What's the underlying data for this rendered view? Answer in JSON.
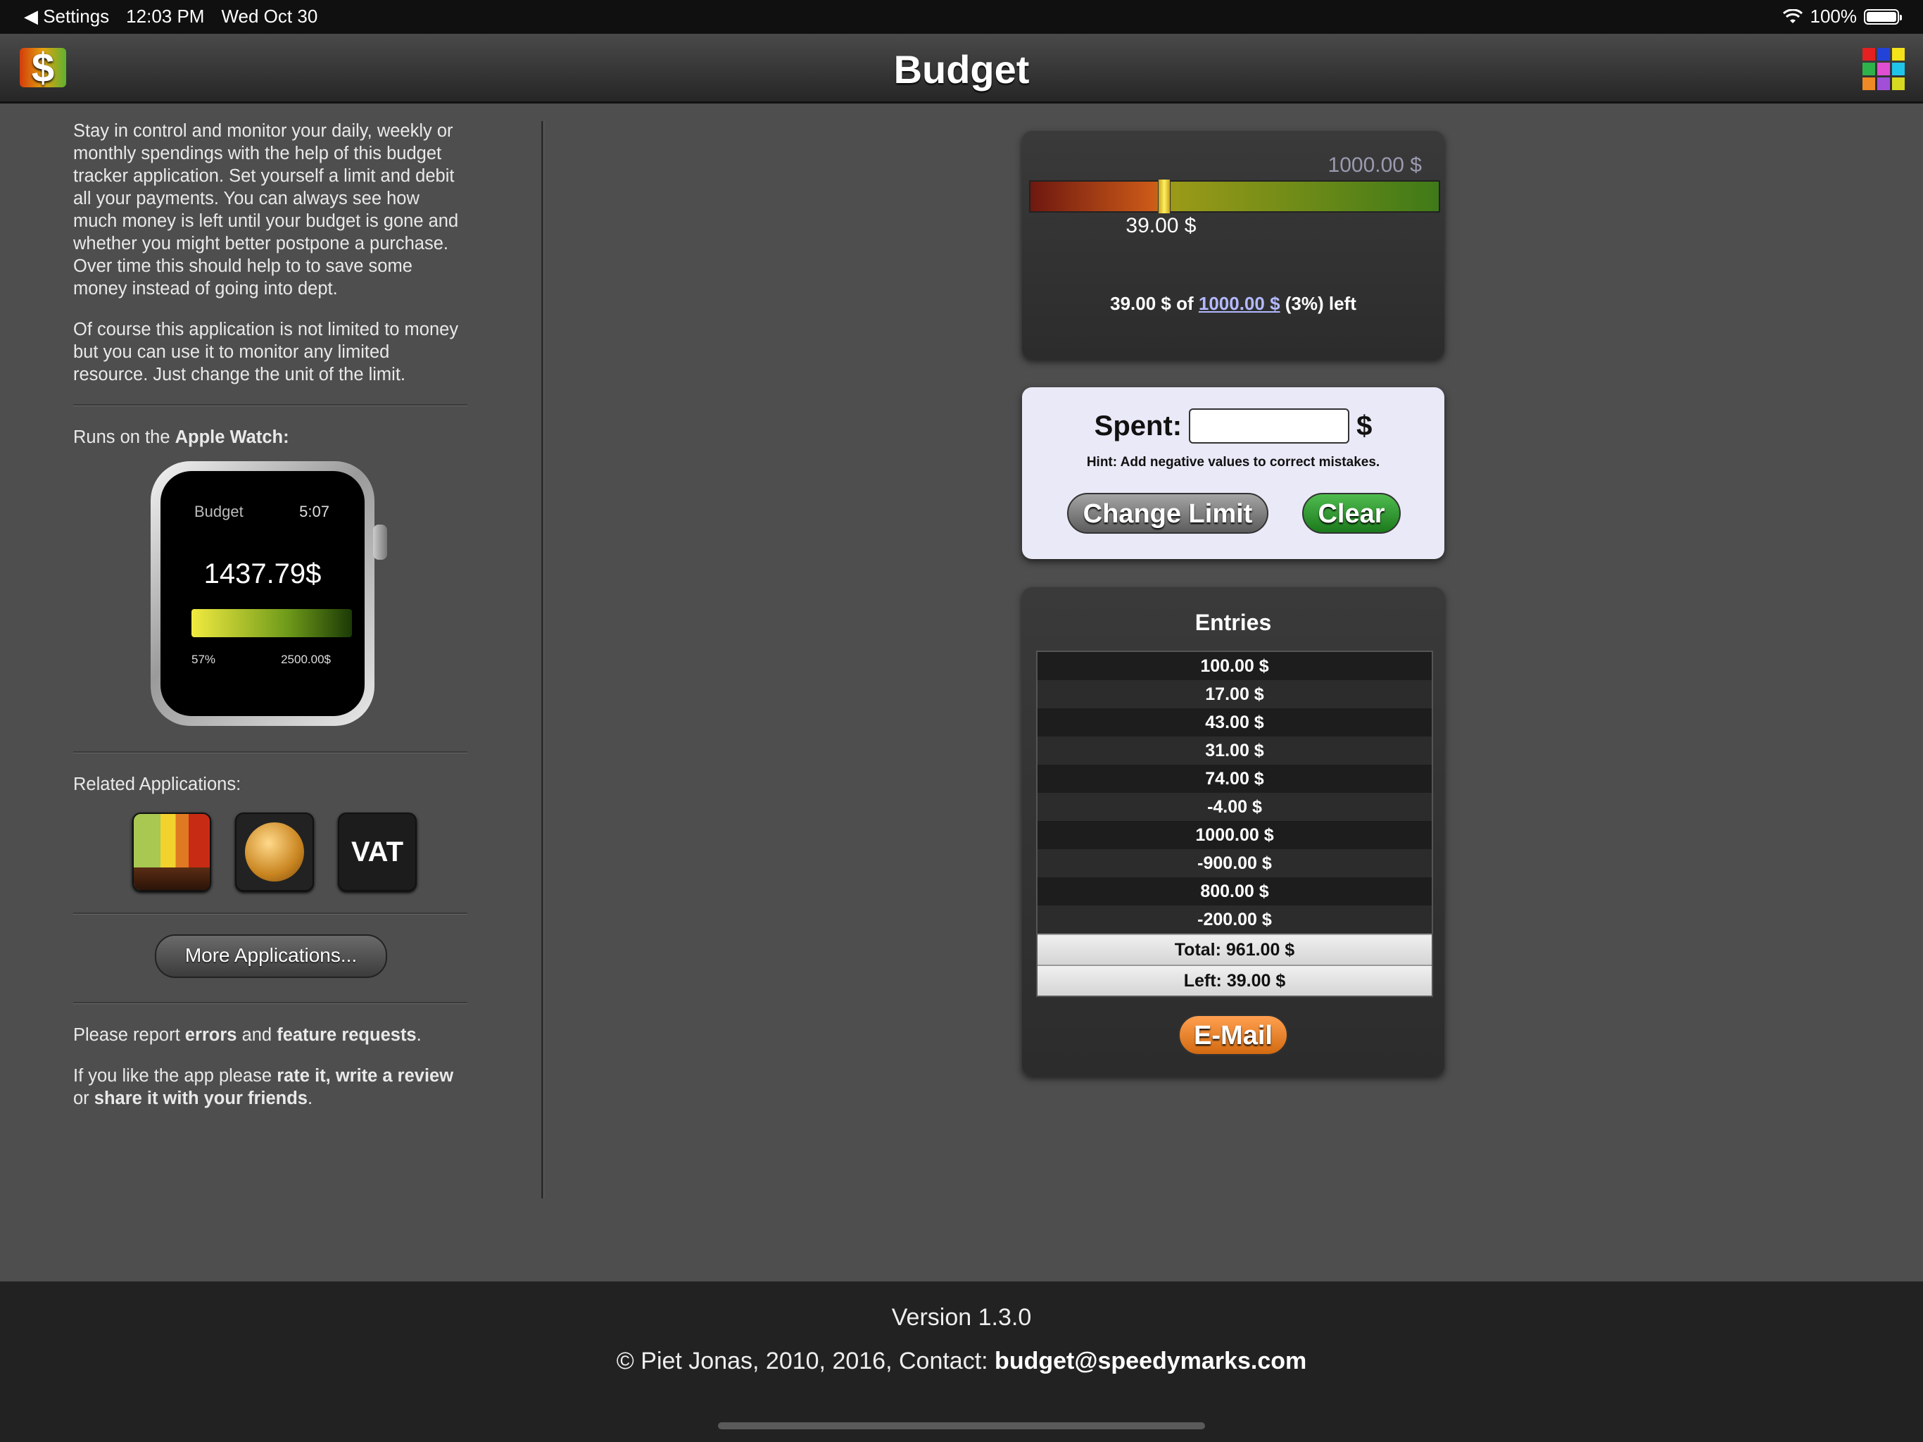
{
  "status_bar": {
    "back_label": "◀ Settings",
    "time": "12:03 PM",
    "date": "Wed Oct 30",
    "battery": "100%"
  },
  "nav": {
    "title": "Budget",
    "app_icon_glyph": "$",
    "app_icon": "dollar-app-icon",
    "grid_icon": "apps-grid-icon",
    "grid_colors": [
      "#e52020",
      "#2343d8",
      "#f4e21a",
      "#2fb24a",
      "#e04fd2",
      "#1fc4e8",
      "#f08a24",
      "#a24fd8",
      "#d8d820"
    ]
  },
  "sidebar": {
    "intro_p1": "Stay in control and monitor your daily, weekly or monthly spendings with the help of this budget tracker application. Set yourself a limit and debit all your payments. You can always see how much money is left until your budget is gone and whether you might better postpone a purchase. Over time this should help to to save some money instead of going into dept.",
    "intro_p2": "Of course this application is not limited to money but you can use it to monitor any limited resource. Just change the unit of the limit.",
    "watch_prefix": "Runs on the ",
    "watch_bold": "Apple Watch:",
    "watch": {
      "title": "Budget",
      "time": "5:07",
      "amount": "1437.79$",
      "percent": "57%",
      "limit": "2500.00$",
      "fill_fraction": 0.57
    },
    "related_label": "Related Applications:",
    "related_apps": [
      "budget-bars-icon",
      "coin-icon",
      "VAT"
    ],
    "more_button": "More Applications...",
    "report_prefix": "Please report ",
    "report_errors": "errors",
    "report_and": " and ",
    "report_features": "feature requests",
    "report_suffix": ".",
    "rate_prefix": "If you like the app please ",
    "rate_bold": "rate it, write a review",
    "rate_mid": " or ",
    "rate_share": "share it with your friends",
    "rate_suffix": "."
  },
  "budget": {
    "limit_display": "1000.00 $",
    "spent_display": "39.00 $",
    "progress_fraction": 0.33,
    "summary_prefix": "39.00 $ of ",
    "summary_link": "1000.00 $",
    "summary_suffix": " (3%) left"
  },
  "spent_form": {
    "label": "Spent:",
    "input_value": "",
    "unit": "$",
    "hint": "Hint: Add negative values to correct mistakes.",
    "change_limit_button": "Change Limit",
    "clear_button": "Clear"
  },
  "entries": {
    "title": "Entries",
    "items": [
      "100.00 $",
      "17.00 $",
      "43.00 $",
      "31.00 $",
      "74.00 $",
      "-4.00 $",
      "1000.00 $",
      "-900.00 $",
      "800.00 $",
      "-200.00 $"
    ],
    "total": "Total: 961.00 $",
    "left": "Left: 39.00 $",
    "email_button": "E-Mail"
  },
  "footer": {
    "version": "Version 1.3.0",
    "copyright": "© Piet Jonas, 2010, 2016, Contact: ",
    "email": "budget@speedymarks.com"
  }
}
